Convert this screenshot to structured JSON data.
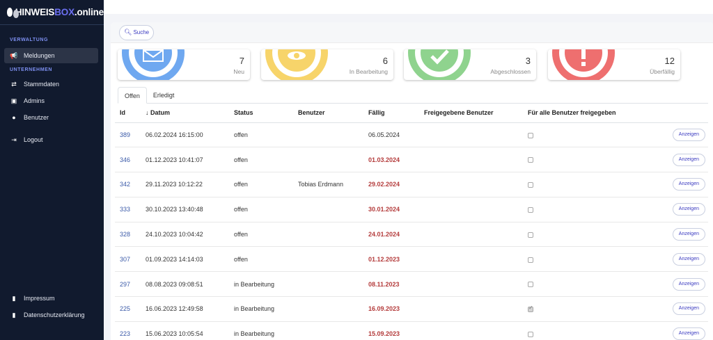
{
  "brand": {
    "part1": "HINWEIS",
    "part2": "BOX",
    "part3": ".online"
  },
  "sidebar": {
    "section_admin": "VERWALTUNG",
    "section_company": "UNTERNEHMEN",
    "items": [
      {
        "label": "Meldungen",
        "icon": "megaphone-icon"
      },
      {
        "label": "Stammdaten",
        "icon": "exchange-icon"
      },
      {
        "label": "Admins",
        "icon": "briefcase-icon"
      },
      {
        "label": "Benutzer",
        "icon": "user-icon"
      },
      {
        "label": "Logout",
        "icon": "logout-icon"
      }
    ],
    "footer": [
      {
        "label": "Impressum",
        "icon": "book-icon"
      },
      {
        "label": "Datenschutzerklärung",
        "icon": "book-icon"
      }
    ]
  },
  "search": {
    "label": "Suche",
    "icon": "search-icon"
  },
  "stats": [
    {
      "value": "7",
      "label": "Neu",
      "color": "#6fa8f0",
      "icon": "envelope-icon"
    },
    {
      "value": "6",
      "label": "In Bearbeitung",
      "color": "#f7d46a",
      "icon": "eye-icon"
    },
    {
      "value": "3",
      "label": "Abgeschlossen",
      "color": "#8fd38e",
      "icon": "checkmark-icon"
    },
    {
      "value": "12",
      "label": "Überfällig",
      "color": "#ee6f6f",
      "icon": "exclamation-icon"
    }
  ],
  "tabs": [
    {
      "label": "Offen"
    },
    {
      "label": "Erledigt"
    }
  ],
  "table": {
    "headers": {
      "id": "Id",
      "date": "↓ Datum",
      "status": "Status",
      "user": "Benutzer",
      "due": "Fällig",
      "shared_users": "Freigegebene Benutzer",
      "shared_all": "Für alle Benutzer freigegeben"
    },
    "action_label": "Anzeigen",
    "rows": [
      {
        "id": "389",
        "date": "06.02.2024 16:15:00",
        "status": "offen",
        "user": "",
        "due": "06.05.2024",
        "overdue": false,
        "shared_all": false
      },
      {
        "id": "346",
        "date": "01.12.2023 10:41:07",
        "status": "offen",
        "user": "",
        "due": "01.03.2024",
        "overdue": true,
        "shared_all": false
      },
      {
        "id": "342",
        "date": "29.11.2023 10:12:22",
        "status": "offen",
        "user": "Tobias Erdmann",
        "due": "29.02.2024",
        "overdue": true,
        "shared_all": false
      },
      {
        "id": "333",
        "date": "30.10.2023 13:40:48",
        "status": "offen",
        "user": "",
        "due": "30.01.2024",
        "overdue": true,
        "shared_all": false
      },
      {
        "id": "328",
        "date": "24.10.2023 10:04:42",
        "status": "offen",
        "user": "",
        "due": "24.01.2024",
        "overdue": true,
        "shared_all": false
      },
      {
        "id": "307",
        "date": "01.09.2023 14:14:03",
        "status": "offen",
        "user": "",
        "due": "01.12.2023",
        "overdue": true,
        "shared_all": false
      },
      {
        "id": "297",
        "date": "08.08.2023 09:08:51",
        "status": "in Bearbeitung",
        "user": "",
        "due": "08.11.2023",
        "overdue": true,
        "shared_all": false
      },
      {
        "id": "225",
        "date": "16.06.2023 12:49:58",
        "status": "in Bearbeitung",
        "user": "",
        "due": "16.09.2023",
        "overdue": true,
        "shared_all": true
      },
      {
        "id": "223",
        "date": "15.06.2023 10:05:54",
        "status": "in Bearbeitung",
        "user": "",
        "due": "15.09.2023",
        "overdue": true,
        "shared_all": false
      }
    ]
  }
}
